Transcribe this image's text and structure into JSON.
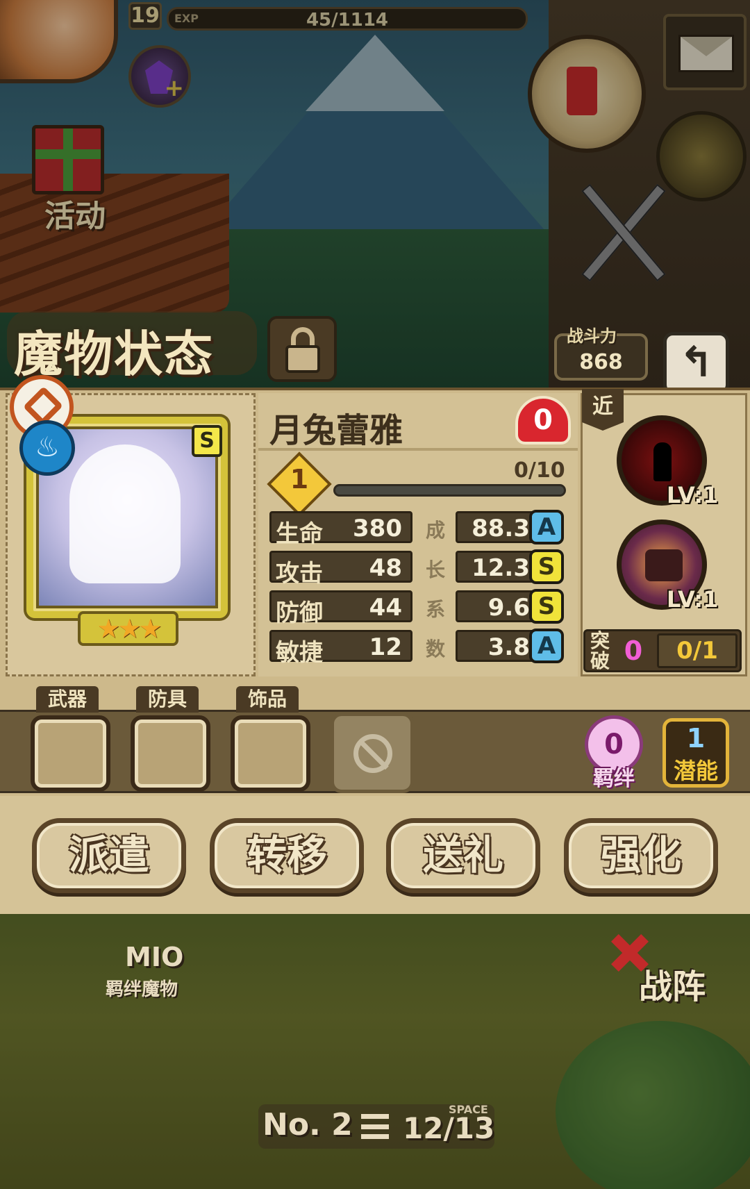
{
  "hud": {
    "player_level": "19",
    "exp_label": "EXP",
    "exp_value": "45/1114",
    "activity_label": "活动"
  },
  "header": {
    "title": "魔物状态",
    "power_label": "战斗力",
    "power_value": "868",
    "back_glyph": "↰"
  },
  "monster": {
    "name": "月兔蕾雅",
    "affection": "0",
    "rank": "S",
    "stars": "★★★",
    "element_glyph": "♨",
    "level": "1",
    "level_exp": "0/10",
    "level_progress": 0,
    "growth_label": "成长系数"
  },
  "stats": [
    {
      "name": "生命",
      "value": "380",
      "growth": "88.3",
      "grade": "A"
    },
    {
      "name": "攻击",
      "value": "48",
      "growth": "12.3",
      "grade": "S"
    },
    {
      "name": "防御",
      "value": "44",
      "growth": "9.6",
      "grade": "S"
    },
    {
      "name": "敏捷",
      "value": "12",
      "growth": "3.8",
      "grade": "A"
    }
  ],
  "skills": {
    "range": "近",
    "skill1_level": "LV:1",
    "skill2_level": "LV:1",
    "breakthrough_label": "突破",
    "breakthrough_count": "0",
    "breakthrough_progress": "0/1"
  },
  "equipment": {
    "weapon_label": "武器",
    "armor_label": "防具",
    "accessory_label": "饰品",
    "bond_count": "0",
    "bond_label": "羁绊",
    "potential_count": "1",
    "potential_label": "潜能"
  },
  "actions": {
    "dispatch": "派遣",
    "transfer": "转移",
    "gift": "送礼",
    "enhance": "强化"
  },
  "bottom": {
    "mio_name": "MIO",
    "mio_sub": "羁绊魔物",
    "formation": "战阵",
    "page_no": "No. 2",
    "space_label": "SPACE",
    "space_value": "12/13"
  },
  "colors": {
    "grade_A": "#5fbde8",
    "grade_S": "#f0e33a",
    "panel": "#cdb98b",
    "heart": "#d9262e"
  }
}
